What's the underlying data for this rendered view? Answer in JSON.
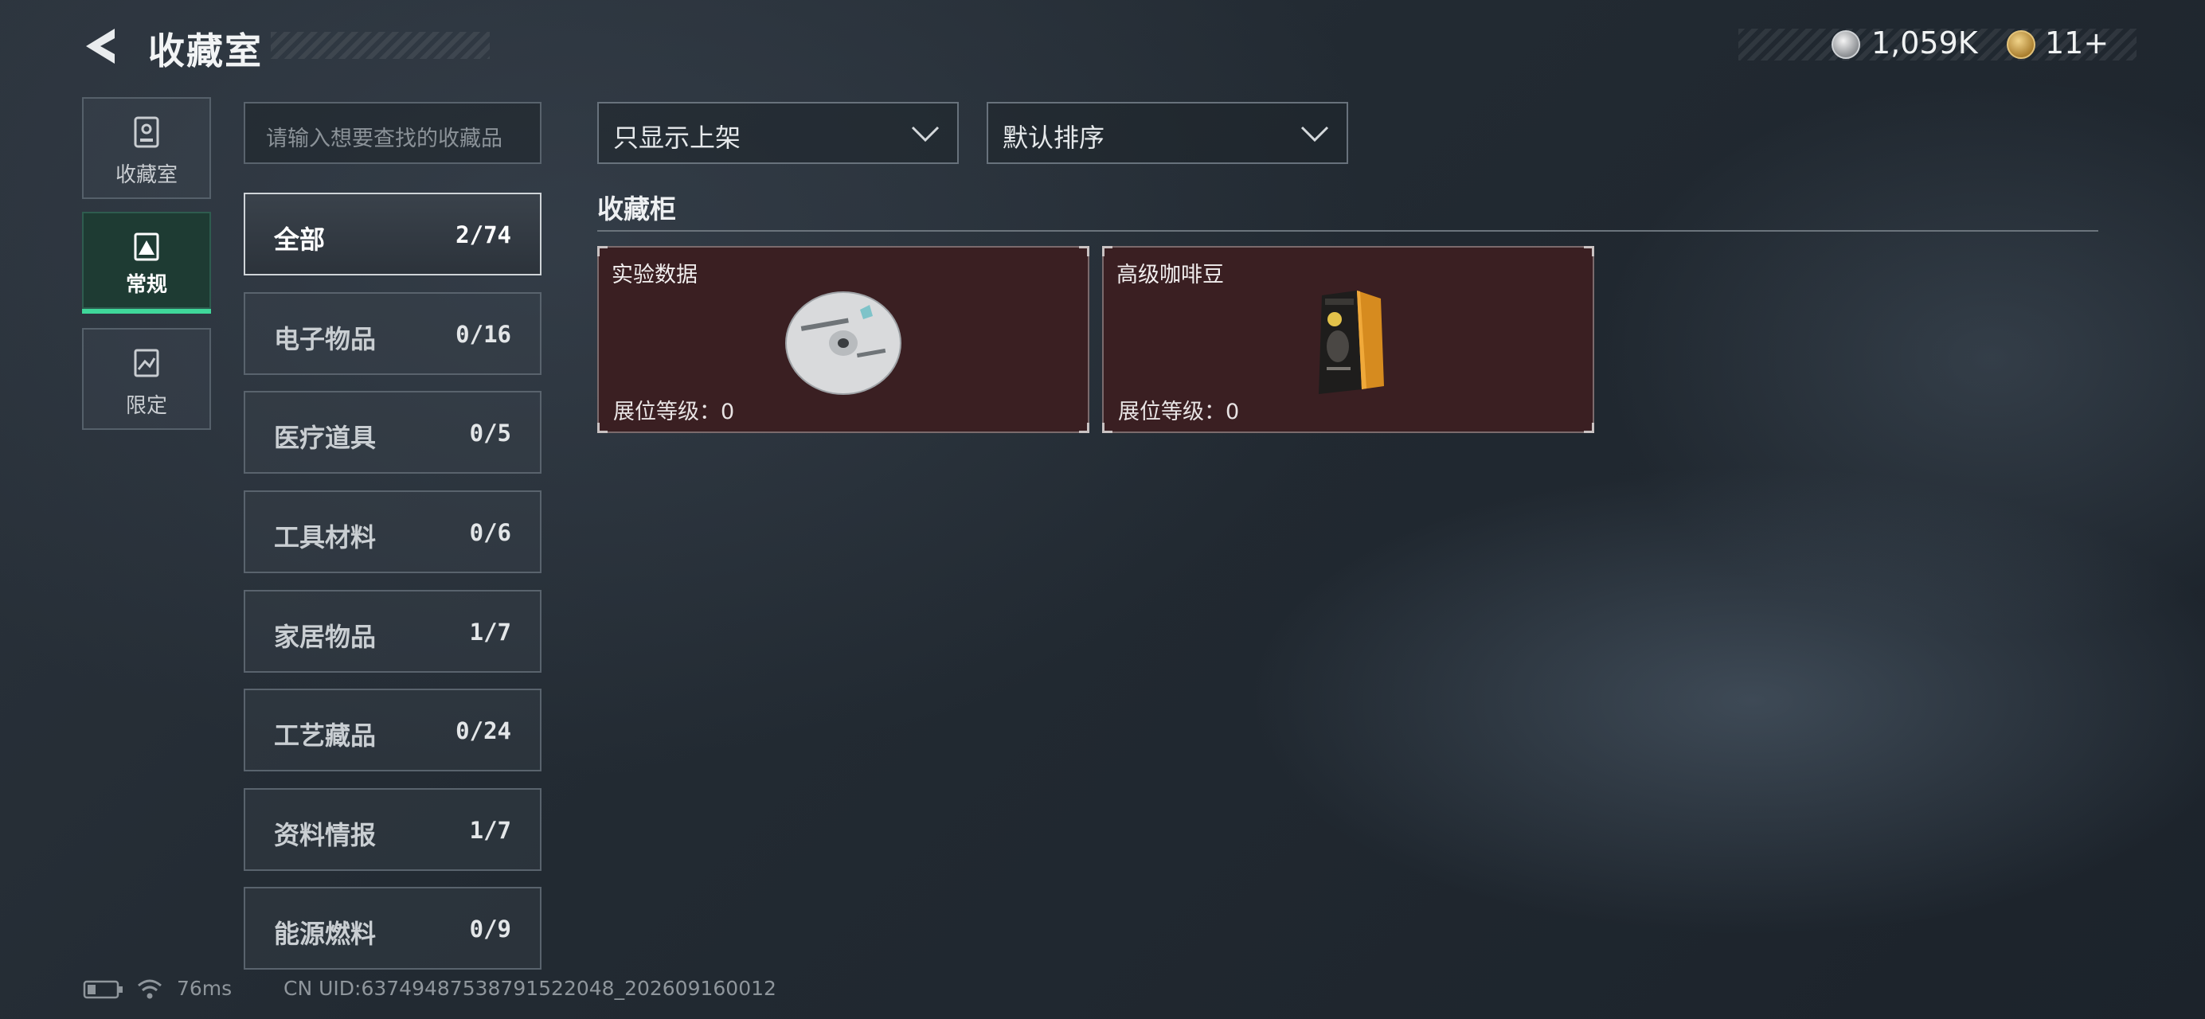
{
  "header": {
    "title": "收藏室",
    "back_icon": "back-arrow-icon"
  },
  "currency": {
    "silver_icon": "silver-coin-icon",
    "silver_amount": "1,059K",
    "gold_icon": "gold-coin-icon",
    "gold_amount": "11+"
  },
  "rail": {
    "items": [
      {
        "label": "收藏室",
        "icon": "collection-room-icon",
        "active": false
      },
      {
        "label": "常规",
        "icon": "regular-icon",
        "active": true
      },
      {
        "label": "限定",
        "icon": "limited-icon",
        "active": false
      }
    ]
  },
  "search": {
    "placeholder": "请输入想要查找的收藏品"
  },
  "categories": [
    {
      "name": "全部",
      "count": "2/74",
      "active": true
    },
    {
      "name": "电子物品",
      "count": "0/16"
    },
    {
      "name": "医疗道具",
      "count": "0/5"
    },
    {
      "name": "工具材料",
      "count": "0/6"
    },
    {
      "name": "家居物品",
      "count": "1/7"
    },
    {
      "name": "工艺藏品",
      "count": "0/24"
    },
    {
      "name": "资料情报",
      "count": "1/7"
    },
    {
      "name": "能源燃料",
      "count": "0/9"
    }
  ],
  "filters": {
    "display_filter": "只显示上架",
    "sort_order": "默认排序"
  },
  "shelf": {
    "title": "收藏柜",
    "items": [
      {
        "name": "实验数据",
        "level_label": "展位等级：0",
        "icon": "data-disc-icon"
      },
      {
        "name": "高级咖啡豆",
        "level_label": "展位等级：0",
        "icon": "coffee-bag-icon"
      }
    ]
  },
  "footer": {
    "ping": "76ms",
    "uid": "CN UID:6374948753879152204 8_202609160012",
    "uid_full": "CN UID:63749487538791522048_202609160012"
  }
}
